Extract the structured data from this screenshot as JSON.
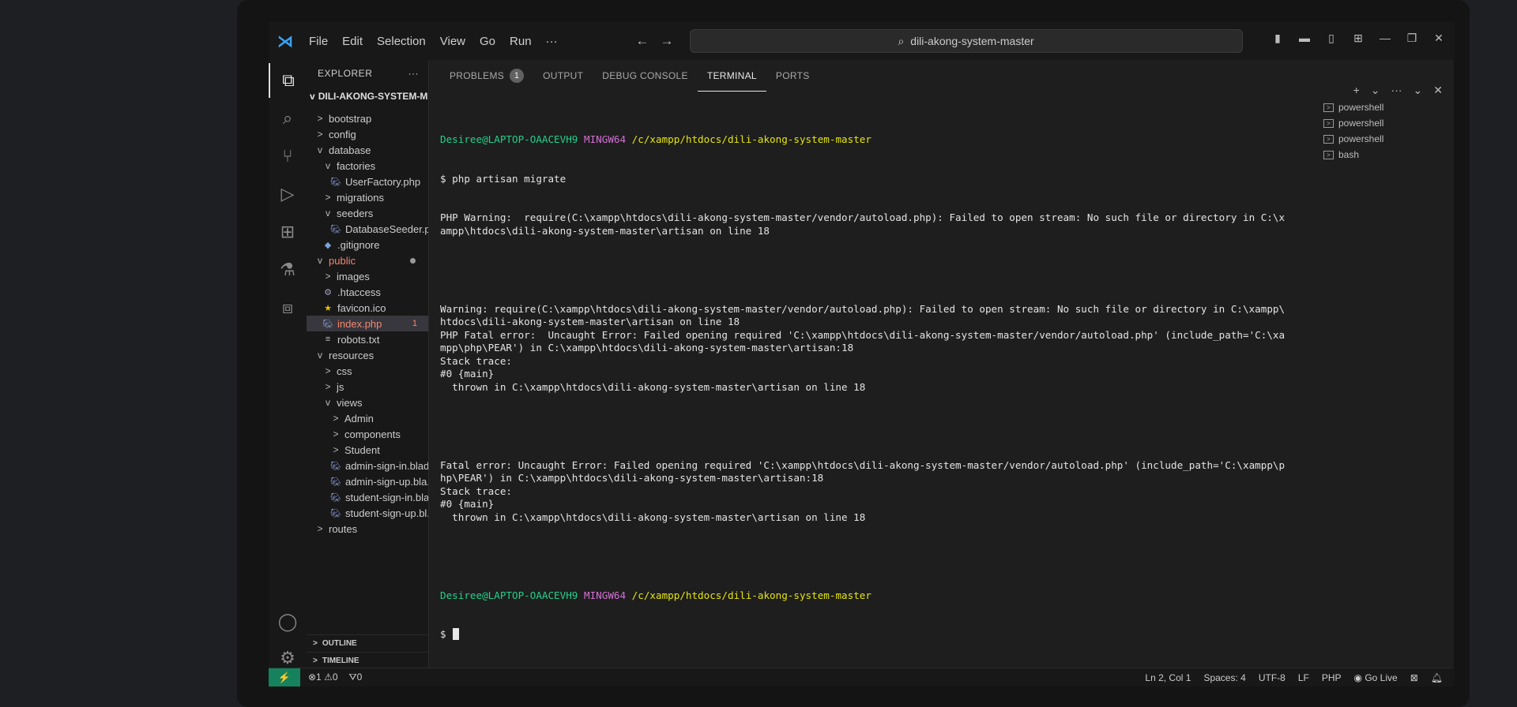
{
  "titlebar": {
    "menu": [
      "File",
      "Edit",
      "Selection",
      "View",
      "Go",
      "Run",
      "···"
    ],
    "search": "dili-akong-system-master"
  },
  "explorer": {
    "title": "EXPLORER",
    "more": "···",
    "root": "DILI-AKONG-SYSTEM-MA...",
    "items": [
      {
        "label": "bootstrap",
        "chev": ">",
        "indent": 1
      },
      {
        "label": "config",
        "chev": ">",
        "indent": 1
      },
      {
        "label": "database",
        "chev": "v",
        "indent": 1
      },
      {
        "label": "factories",
        "chev": "v",
        "indent": 2
      },
      {
        "label": "UserFactory.php",
        "icon": "php",
        "indent": 3
      },
      {
        "label": "migrations",
        "chev": ">",
        "indent": 2
      },
      {
        "label": "seeders",
        "chev": "v",
        "indent": 2
      },
      {
        "label": "DatabaseSeeder.php",
        "icon": "php",
        "indent": 3
      },
      {
        "label": ".gitignore",
        "icon": "git",
        "indent": 2
      },
      {
        "label": "public",
        "chev": "v",
        "indent": 1,
        "modified": true,
        "dot": true
      },
      {
        "label": "images",
        "chev": ">",
        "indent": 2
      },
      {
        "label": ".htaccess",
        "icon": "gear",
        "indent": 2
      },
      {
        "label": "favicon.ico",
        "icon": "star",
        "indent": 2
      },
      {
        "label": "index.php",
        "icon": "php",
        "indent": 2,
        "modified": true,
        "selected": true,
        "badge": "1"
      },
      {
        "label": "robots.txt",
        "icon": "txt",
        "indent": 2
      },
      {
        "label": "resources",
        "chev": "v",
        "indent": 1
      },
      {
        "label": "css",
        "chev": ">",
        "indent": 2
      },
      {
        "label": "js",
        "chev": ">",
        "indent": 2
      },
      {
        "label": "views",
        "chev": "v",
        "indent": 2
      },
      {
        "label": "Admin",
        "chev": ">",
        "indent": 3
      },
      {
        "label": "components",
        "chev": ">",
        "indent": 3
      },
      {
        "label": "Student",
        "chev": ">",
        "indent": 3
      },
      {
        "label": "admin-sign-in.blad...",
        "icon": "php",
        "indent": 3
      },
      {
        "label": "admin-sign-up.bla...",
        "icon": "php",
        "indent": 3
      },
      {
        "label": "student-sign-in.bla...",
        "icon": "php",
        "indent": 3
      },
      {
        "label": "student-sign-up.bl...",
        "icon": "php",
        "indent": 3
      },
      {
        "label": "routes",
        "chev": ">",
        "indent": 1
      }
    ],
    "outline": "OUTLINE",
    "timeline": "TIMELINE"
  },
  "panel": {
    "tabs": [
      {
        "label": "PROBLEMS",
        "count": "1"
      },
      {
        "label": "OUTPUT"
      },
      {
        "label": "DEBUG CONSOLE"
      },
      {
        "label": "TERMINAL",
        "active": true
      },
      {
        "label": "PORTS"
      }
    ],
    "actions": [
      "+",
      "⌄",
      "···",
      "⌄",
      "✕"
    ]
  },
  "terminal": {
    "prompt_user": "Desiree@LAPTOP-OAACEVH9",
    "prompt_env": "MINGW64",
    "prompt_path": "/c/xampp/htdocs/dili-akong-system-master",
    "command": "$ php artisan migrate",
    "output_block1": [
      "PHP Warning:  require(C:\\xampp\\htdocs\\dili-akong-system-master/vendor/autoload.php): Failed to open stream: No such file or directory in C:\\x",
      "ampp\\htdocs\\dili-akong-system-master\\artisan on line 18"
    ],
    "output_block2": [
      "Warning: require(C:\\xampp\\htdocs\\dili-akong-system-master/vendor/autoload.php): Failed to open stream: No such file or directory in C:\\xampp\\",
      "htdocs\\dili-akong-system-master\\artisan on line 18",
      "PHP Fatal error:  Uncaught Error: Failed opening required 'C:\\xampp\\htdocs\\dili-akong-system-master/vendor/autoload.php' (include_path='C:\\xa",
      "mpp\\php\\PEAR') in C:\\xampp\\htdocs\\dili-akong-system-master\\artisan:18",
      "Stack trace:",
      "#0 {main}",
      "  thrown in C:\\xampp\\htdocs\\dili-akong-system-master\\artisan on line 18"
    ],
    "output_block3": [
      "Fatal error: Uncaught Error: Failed opening required 'C:\\xampp\\htdocs\\dili-akong-system-master/vendor/autoload.php' (include_path='C:\\xampp\\p",
      "hp\\PEAR') in C:\\xampp\\htdocs\\dili-akong-system-master\\artisan:18",
      "Stack trace:",
      "#0 {main}",
      "  thrown in C:\\xampp\\htdocs\\dili-akong-system-master\\artisan on line 18"
    ],
    "final_prompt": "$"
  },
  "terminal_list": [
    "powershell",
    "powershell",
    "powershell",
    "bash"
  ],
  "statusbar": {
    "remote": "⚡",
    "problems": "⊗1 ⚠0",
    "ports": "⛛0",
    "position": "Ln 2, Col 1",
    "spaces": "Spaces: 4",
    "encoding": "UTF-8",
    "eol": "LF",
    "language": "PHP",
    "golive": "◉ Go Live"
  }
}
